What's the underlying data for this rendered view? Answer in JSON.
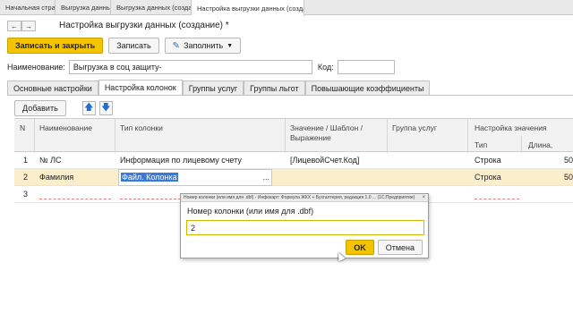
{
  "window_tabs": [
    {
      "label": "Начальная страница",
      "active": false
    },
    {
      "label": "Выгрузка данных",
      "active": false
    },
    {
      "label": "Выгрузка данных (создание)",
      "active": false
    },
    {
      "label": "Настройка выгрузки данных (создание) *",
      "active": true
    }
  ],
  "form": {
    "title": "Настройка выгрузки данных (создание) *",
    "nav_back_icon": "arrow-left-icon",
    "nav_forward_icon": "arrow-right-icon"
  },
  "toolbar": {
    "save_close_label": "Записать и закрыть",
    "save_label": "Записать",
    "fill_label": "Заполнить"
  },
  "fields": {
    "name_label": "Наименование:",
    "name_value": "Выгрузка в соц защиту-",
    "code_label": "Код:",
    "code_value": ""
  },
  "form_tabs": [
    {
      "label": "Основные настройки",
      "active": false
    },
    {
      "label": "Настройка колонок",
      "active": true
    },
    {
      "label": "Группы услуг",
      "active": false
    },
    {
      "label": "Группы льгот",
      "active": false
    },
    {
      "label": "Повышающие коэффициенты",
      "active": false
    }
  ],
  "table_toolbar": {
    "add_label": "Добавить"
  },
  "table": {
    "headers": {
      "n": "N",
      "name": "Наименование",
      "col_type": "Тип колонки",
      "value": "Значение / Шаблон /",
      "value2": "Выражение",
      "group": "Группа услуг",
      "setting": "Настройка значения",
      "sub_type": "Тип",
      "sub_length": "Длина,"
    },
    "rows": [
      {
        "n": "1",
        "name": "№ ЛС",
        "col_type": "Информация по лицевому счету",
        "value": "[ЛицевойСчет.Код]",
        "type": "Строка",
        "length": "50"
      },
      {
        "n": "2",
        "name": "Фамилия",
        "col_type": "Файл. Колонка",
        "value": "",
        "type": "Строка",
        "length": "50"
      },
      {
        "n": "3",
        "name": "",
        "col_type": "",
        "value": "",
        "type": "",
        "length": ""
      }
    ]
  },
  "dialog": {
    "title": "Номер колонки (или имя для .dbf) - Инфокарт: Формула ЖКХ + Бухгалтерия, редакция 1.0 ... (1С:Предприятие)",
    "label": "Номер колонки (или имя для .dbf)",
    "input_value": "2",
    "ok_label": "OK",
    "cancel_label": "Отмена"
  },
  "colors": {
    "accent": "#f5c400",
    "selection": "#fbeecb",
    "highlight": "#3c78d8"
  }
}
